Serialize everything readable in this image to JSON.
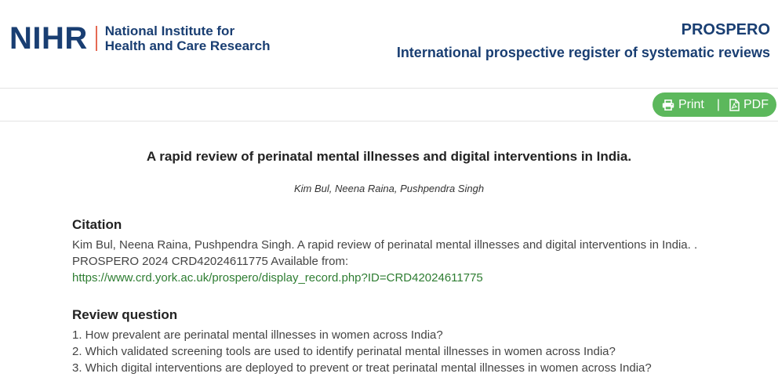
{
  "header": {
    "logo_mark": "NIHR",
    "logo_line1": "National Institute for",
    "logo_line2": "Health and Care Research",
    "brand_name": "PROSPERO",
    "brand_tagline": "International prospective register of systematic reviews"
  },
  "toolbar": {
    "print_label": "Print",
    "separator": "|",
    "pdf_label": "PDF"
  },
  "record": {
    "title": "A rapid review of perinatal mental illnesses and digital interventions in India.",
    "authors": "Kim Bul, Neena Raina, Pushpendra Singh"
  },
  "citation": {
    "heading": "Citation",
    "text": "Kim Bul, Neena Raina, Pushpendra Singh. A rapid review of perinatal mental illnesses and digital interventions in India. . PROSPERO 2024 CRD42024611775 Available from:",
    "link": "https://www.crd.york.ac.uk/prospero/display_record.php?ID=CRD42024611775"
  },
  "review_question": {
    "heading": "Review question",
    "items": [
      "1. How prevalent are perinatal mental illnesses in women across India?",
      "2. Which validated screening tools are used to identify perinatal mental illnesses in women across India?",
      "3. Which digital interventions are deployed to prevent or treat perinatal mental illnesses in women across India?"
    ]
  },
  "colors": {
    "brand_navy": "#193e72",
    "accent_coral": "#e56a54",
    "action_green": "#5cb85c",
    "link_green": "#2e7d32"
  }
}
